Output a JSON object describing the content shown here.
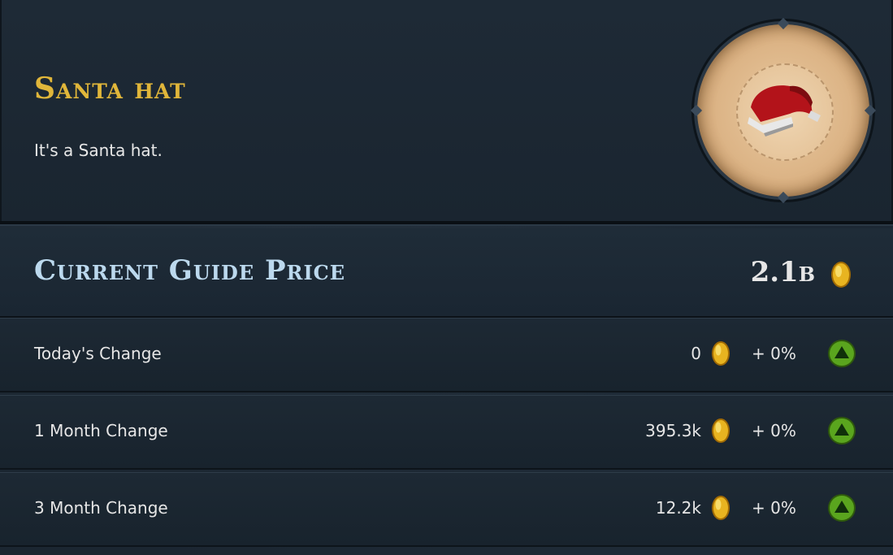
{
  "item": {
    "name": "Santa hat",
    "description": "It's a Santa hat."
  },
  "price": {
    "title": "Current Guide Price",
    "value": "2.1b",
    "icon": "coin-icon"
  },
  "changes": [
    {
      "label": "Today's Change",
      "amount": "0",
      "percent": "+ 0%",
      "trend": "up"
    },
    {
      "label": "1 Month Change",
      "amount": "395.3k",
      "percent": "+ 0%",
      "trend": "up"
    },
    {
      "label": "3 Month Change",
      "amount": "12.2k",
      "percent": "+ 0%",
      "trend": "up"
    }
  ],
  "colors": {
    "title_gold": "#e0b63a",
    "price_title_blue": "#bcd9ee",
    "trend_green": "#5aa51e",
    "coin_gold": "#e8b420"
  }
}
